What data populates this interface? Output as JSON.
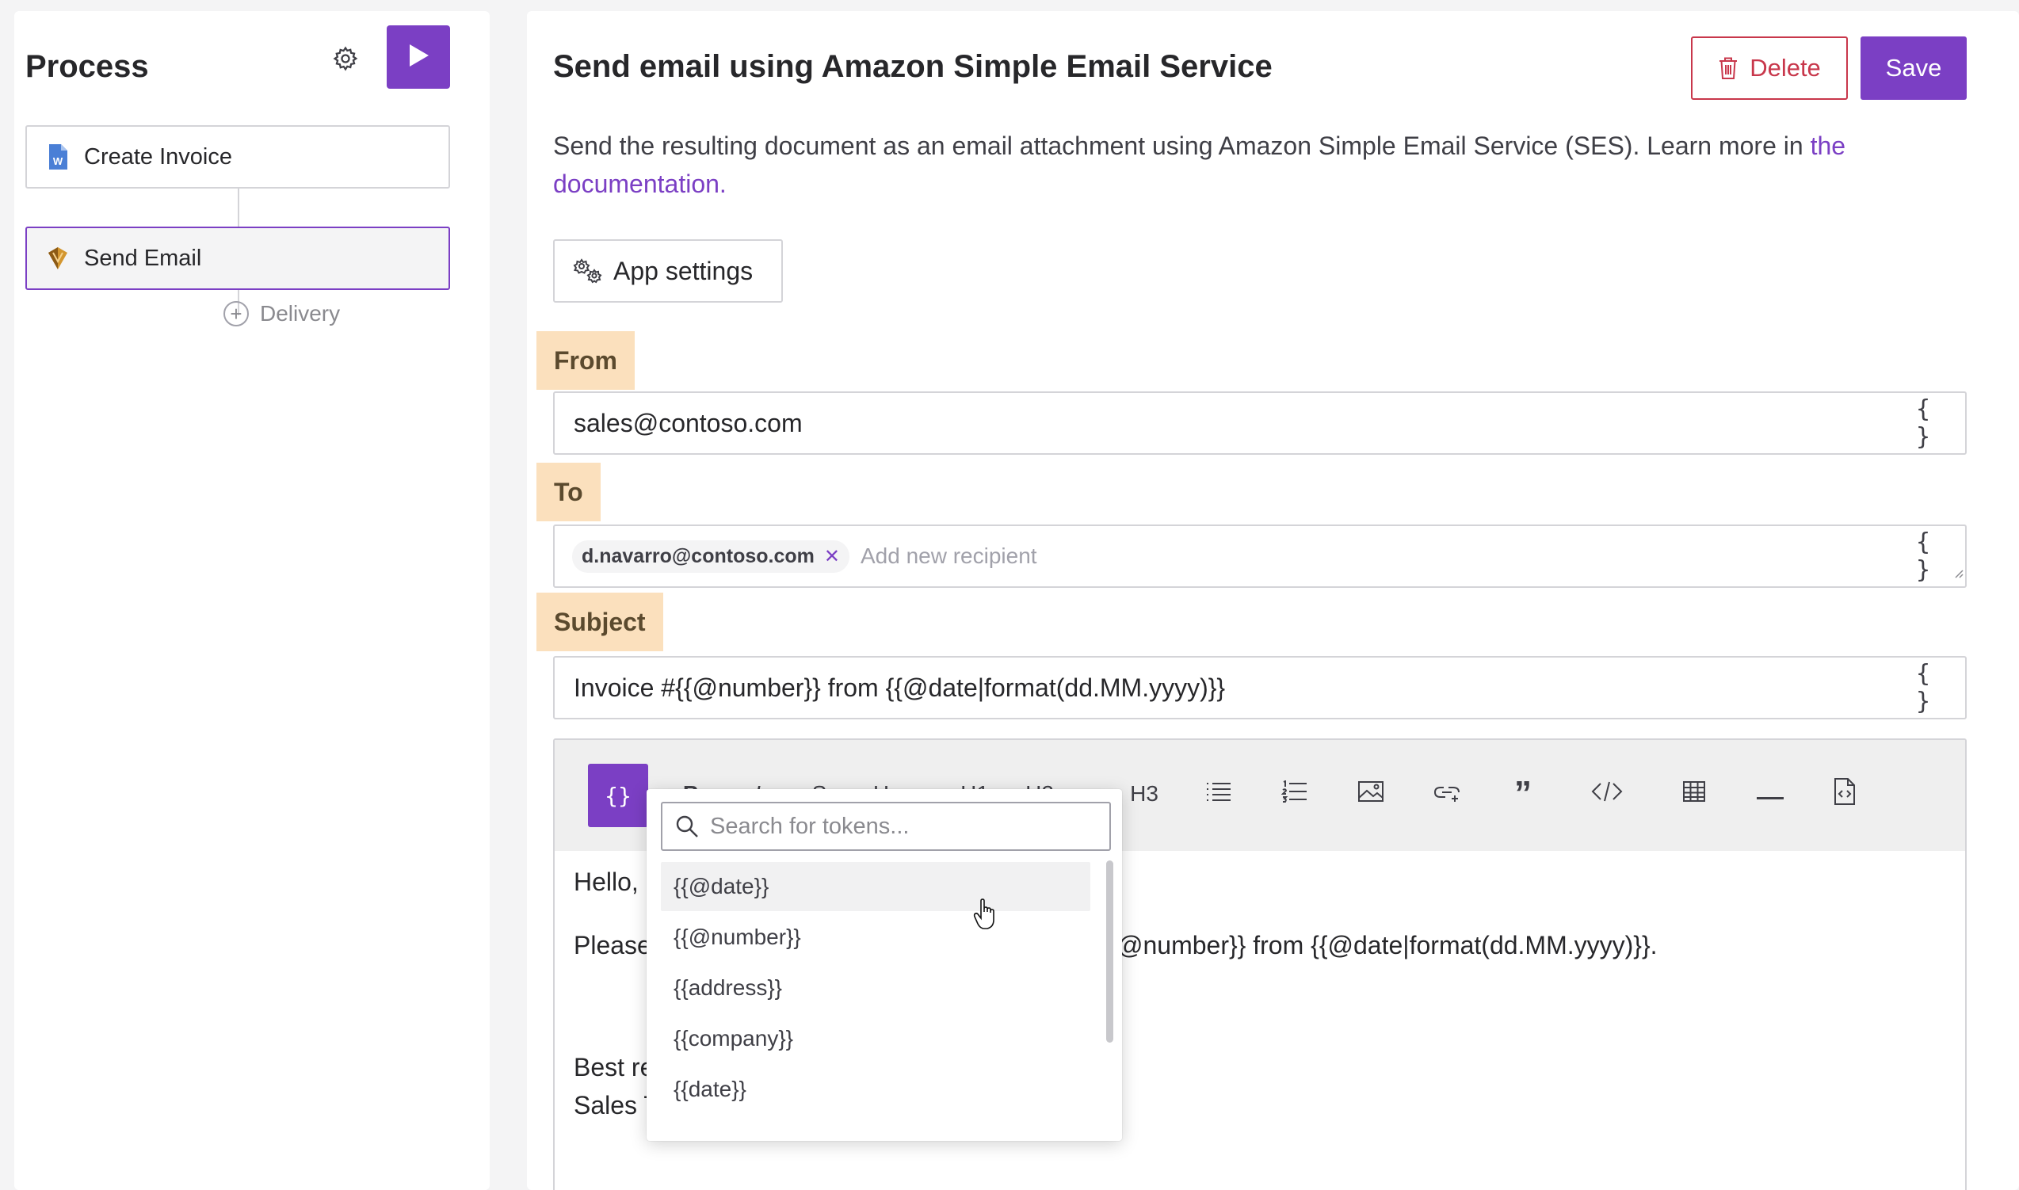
{
  "sidebar": {
    "title": "Process",
    "steps": [
      {
        "label": "Create Invoice",
        "icon": "word-document-icon"
      },
      {
        "label": "Send Email",
        "icon": "amazon-ses-icon"
      }
    ],
    "delivery_label": "Delivery"
  },
  "header": {
    "title": "Send email using Amazon Simple Email Service",
    "delete_label": "Delete",
    "save_label": "Save"
  },
  "description": {
    "text": "Send the resulting document as an email attachment using Amazon Simple Email Service (SES). Learn more in ",
    "link_text": "the documentation."
  },
  "app_settings_label": "App settings",
  "form": {
    "from": {
      "label": "From",
      "value": "sales@contoso.com"
    },
    "to": {
      "label": "To",
      "recipients": [
        "d.navarro@contoso.com"
      ],
      "placeholder": "Add new recipient"
    },
    "subject": {
      "label": "Subject",
      "value": "Invoice #{{@number}} from {{@date|format(dd.MM.yyyy)}}"
    },
    "token_button_label": "{ }"
  },
  "editor": {
    "toolbar": {
      "token": "{}",
      "h3": "H3",
      "quote": "”"
    },
    "body": {
      "line1_left": "Hello,",
      "line2_left": "Please",
      "line2_right": "@number}} from {{@date|format(dd.MM.yyyy)}}.",
      "line3_left": "Best re",
      "line4_left": "Sales T"
    }
  },
  "token_popup": {
    "search_placeholder": "Search for tokens...",
    "items": [
      "{{@date}}",
      "{{@number}}",
      "{{address}}",
      "{{company}}",
      "{{date}}"
    ]
  },
  "colors": {
    "accent": "#7b3fc4",
    "danger": "#c8374b",
    "label_bg": "#fbe0bd"
  }
}
